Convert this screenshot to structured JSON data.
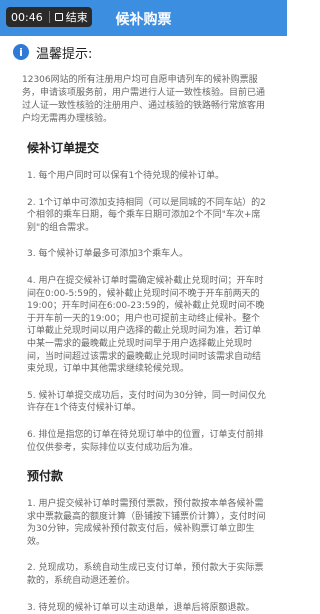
{
  "status_bar": {
    "time": "00:46",
    "end_label": "结束"
  },
  "header": {
    "title": "候补购票"
  },
  "notice": {
    "icon": "info-icon",
    "title": "温馨提示:",
    "intro": "12306网站的所有注册用户均可自愿申请列车的候补购票服务，申请该项服务前，用户需进行人证一致性核验。目前已通过人证一致性核验的注册用户、通过核验的铁路畅行常旅客用户均无需再办理核验。"
  },
  "sections": [
    {
      "title": "候补订单提交",
      "items": [
        "1. 每个用户同时可以保有1个待兑现的候补订单。",
        "2. 1个订单中可添加支持相同（可以是同城的不同车站）的2个相邻的乘车日期，每个乘车日期可添加2个不同\"车次+席别\"的组合需求。",
        "3. 每个候补订单最多可添加3个乘车人。",
        "4. 用户在提交候补订单时需确定候补截止兑现时间；开车时间在0:00-5:59的，候补截止兑现时间不晚于开车前两天的19:00；开车时间在6:00-23:59的，候补截止兑现时间不晚于开车前一天的19:00；用户也可提前主动终止候补。整个订单截止兑现时间以用户选择的截止兑现时间为准，若订单中某一需求的最晚截止兑现时间早于用户选择截止兑现时间，当时间超过该需求的最晚截止兑现时间时该需求自动结束兑现，订单中其他需求继续轮候兑现。",
        "5. 候补订单提交成功后，支付时间为30分钟，同一时间仅允许存在1个待支付候补订单。",
        "6. 排位是指您的订单在待兑现订单中的位置，订单支付前排位仅供参考，实际排位以支付成功后为准。"
      ]
    },
    {
      "title": "预付款",
      "items": [
        "1. 用户提交候补订单时需预付票款，预付款按本单各候补需求中票款最高的额度计算（卧铺按下铺票价计算），支付时间为30分钟，完成候补预付款支付后，候补购票订单立即生效。",
        "2. 兑现成功，系统自动生成已支付订单，预付款大于实际票款的，系统自动退还差价。",
        "3. 待兑现的候补订单可以主动退单，退单后将原额退款。"
      ]
    }
  ]
}
